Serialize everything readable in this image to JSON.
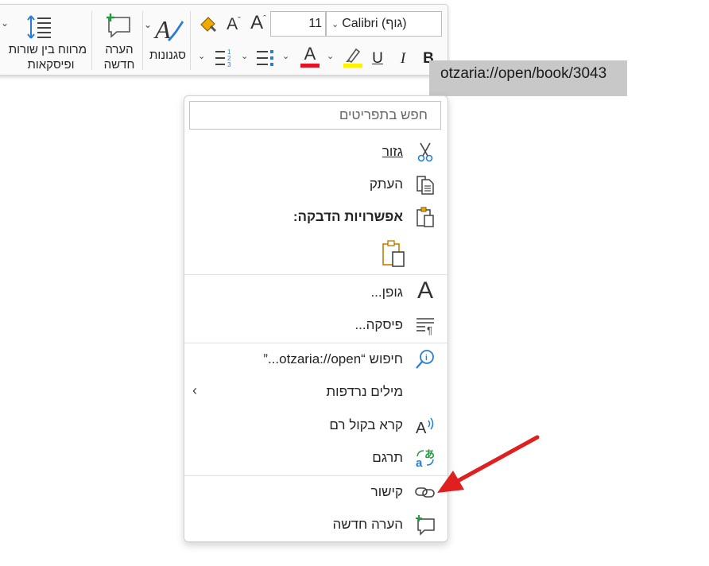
{
  "toolbar": {
    "line_spacing_label_1": "מרווח בין שורות",
    "line_spacing_label_2": "ופיסקאות",
    "new_comment_label_1": "הערה",
    "new_comment_label_2": "חדשה",
    "styles_label": "סגנונות",
    "font_size": "11",
    "font_name": "Calibri (גוף)",
    "bold": "B",
    "italic": "I",
    "underline": "U",
    "font_color": "#e81123",
    "highlight_color": "#fff100"
  },
  "document": {
    "selected_text": "otzaria://open/book/3043"
  },
  "context_menu": {
    "search_placeholder": "חפש בתפריטים",
    "items": [
      {
        "label": "גזור",
        "icon": "scissors-icon"
      },
      {
        "label": "העתק",
        "icon": "copy-icon"
      },
      {
        "label": "אפשרויות הדבקה:",
        "icon": "paste-icon"
      },
      {
        "label": "גופן...",
        "icon": "font-icon"
      },
      {
        "label": "פיסקה...",
        "icon": "paragraph-icon"
      },
      {
        "label": "חיפוש “otzaria://open...”",
        "icon": "search-icon"
      },
      {
        "label": "מילים נרדפות",
        "icon": "synonyms-icon"
      },
      {
        "label": "קרא בקול רם",
        "icon": "read-aloud-icon"
      },
      {
        "label": "תרגם",
        "icon": "translate-icon"
      },
      {
        "label": "קישור",
        "icon": "link-icon"
      },
      {
        "label": "הערה חדשה",
        "icon": "new-comment-icon"
      }
    ]
  },
  "annotation": {
    "arrow_color": "#e02020"
  }
}
